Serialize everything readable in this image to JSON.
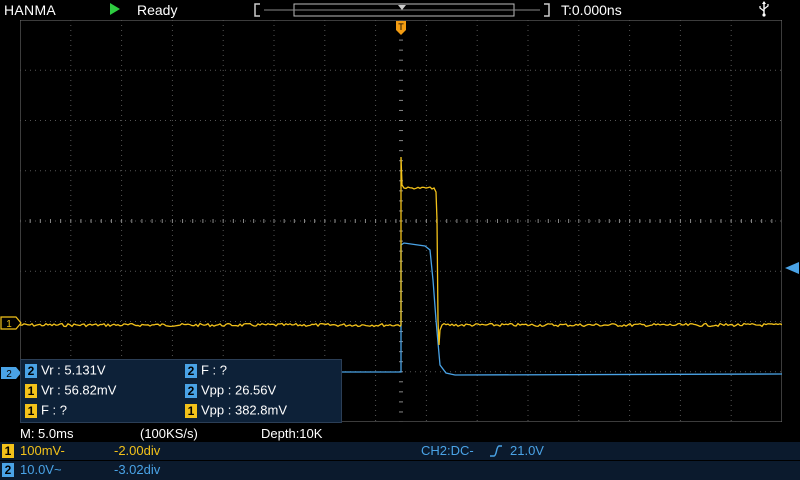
{
  "header": {
    "brand": "HANMA",
    "run_state": "Ready",
    "trigger_time": "T:0.000ns",
    "usb_icon": "usb-icon"
  },
  "markers": {
    "trigger_position_label": "T",
    "ch1_marker_label": "1",
    "ch2_marker_label": "2"
  },
  "colors": {
    "ch1": "#f3c21a",
    "ch2": "#4aa3e6",
    "grid": "#5a5a5a",
    "run": "#2ecc40"
  },
  "measurements": [
    {
      "channel": "2",
      "text": "Vr : 5.131V"
    },
    {
      "channel": "2",
      "text": "F :    ?"
    },
    {
      "channel": "1",
      "text": "Vr : 56.82mV"
    },
    {
      "channel": "2",
      "text": "Vpp : 26.56V"
    },
    {
      "channel": "1",
      "text": "F :    ?"
    },
    {
      "channel": "1",
      "text": "Vpp : 382.8mV"
    }
  ],
  "timebase": {
    "scale": "M: 5.0ms",
    "sample_rate": "(100KS/s)",
    "depth": "Depth:10K"
  },
  "channels": [
    {
      "id": "1",
      "scale": "100mV-",
      "offset": "-2.00div"
    },
    {
      "id": "2",
      "scale": "10.0V~",
      "offset": "-3.02div"
    }
  ],
  "trigger": {
    "setting": "CH2:DC-",
    "level": "21.0V"
  }
}
